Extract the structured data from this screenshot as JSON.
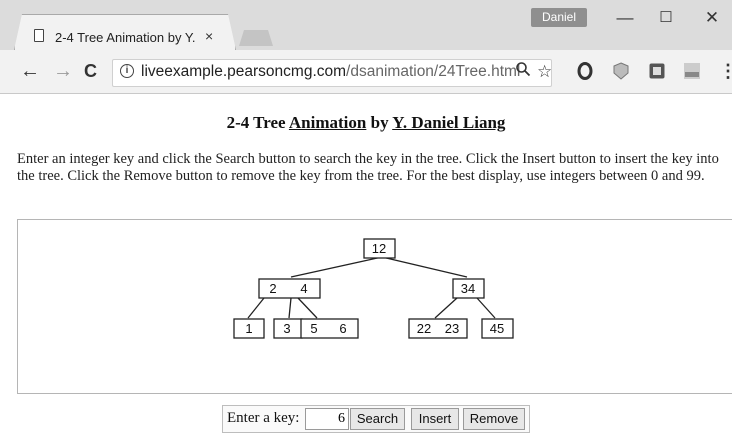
{
  "browser": {
    "tab_title": "2-4 Tree Animation by Y.",
    "tab_close": "×",
    "profile_name": "Daniel",
    "window_controls": {
      "minimize": "—",
      "maximize": "☐",
      "close": "✕"
    },
    "nav": {
      "back": "←",
      "forward": "→",
      "reload": "C"
    },
    "url_host": "liveexample.pearsoncmg.com",
    "url_path": "/dsanimation/24Tree.html",
    "omnibox_icons": [
      "zoom-icon",
      "star-icon"
    ],
    "extensions": [
      "opera-extension-icon",
      "shield-extension-icon",
      "square-extension-icon",
      "qee-extension-icon"
    ],
    "menu": "⋮"
  },
  "page": {
    "title_prefix": "2-4 Tree ",
    "title_link": "Animation",
    "title_by": " by ",
    "title_author": "Y. Daniel Liang",
    "intro": "Enter an integer key and click the Search button to search the key in the tree. Click the Insert button to insert the key into the tree. Click the Remove button to remove the key from the tree. For the best display, use integers between 0 and 99."
  },
  "tree": {
    "nodes": [
      {
        "id": "root",
        "keys": [
          "12"
        ]
      },
      {
        "id": "left",
        "keys": [
          "2",
          "4"
        ]
      },
      {
        "id": "right",
        "keys": [
          "34"
        ]
      },
      {
        "id": "leaf-1",
        "keys": [
          "1"
        ]
      },
      {
        "id": "leaf-3",
        "keys": [
          "3"
        ]
      },
      {
        "id": "leaf-5-6",
        "keys": [
          "5",
          "6"
        ]
      },
      {
        "id": "leaf-22-23",
        "keys": [
          "22",
          "23"
        ]
      },
      {
        "id": "leaf-45",
        "keys": [
          "45"
        ]
      }
    ]
  },
  "controls": {
    "key_label": "Enter a key:",
    "key_value": "6",
    "search_label": "Search",
    "insert_label": "Insert",
    "remove_label": "Remove"
  }
}
